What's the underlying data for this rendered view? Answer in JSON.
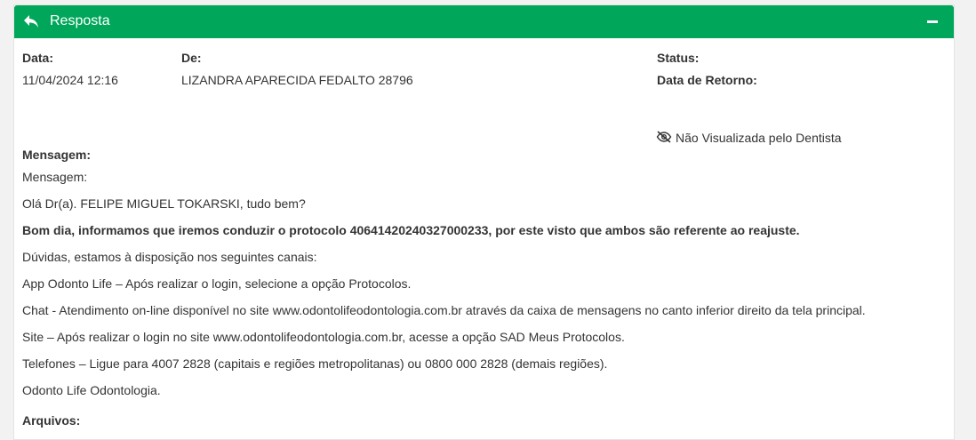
{
  "header": {
    "title": "Resposta",
    "reply_icon": "reply-arrow-icon",
    "collapse_icon": "minus-icon"
  },
  "fields": {
    "date_label": "Data:",
    "date_value": "11/04/2024 12:16",
    "from_label": "De:",
    "from_value": "LIZANDRA APARECIDA FEDALTO 28796",
    "status_label": "Status:",
    "return_label": "Data de Retorno:"
  },
  "visibility": {
    "icon": "eye-slash-icon",
    "text": "Não Visualizada pelo Dentista"
  },
  "message": {
    "label": "Mensagem:",
    "lines": [
      "Mensagem:",
      "Olá Dr(a). FELIPE MIGUEL TOKARSKI, tudo bem?",
      "Bom dia, informamos que iremos conduzir o protocolo 40641420240327000233, por este visto que ambos são referente ao reajuste.",
      "Dúvidas, estamos à disposição nos seguintes canais:",
      "App Odonto Life – Após realizar o login, selecione a opção Protocolos.",
      "Chat - Atendimento on-line disponível no site www.odontolifeodontologia.com.br através da caixa de mensagens no canto inferior direito da tela principal.",
      "Site – Após realizar o login no site www.odontolifeodontologia.com.br, acesse a opção SAD Meus Protocolos.",
      "Telefones – Ligue para 4007 2828 (capitais e regiões metropolitanas) ou 0800 000 2828 (demais regiões).",
      "Odonto Life Odontologia."
    ]
  },
  "files": {
    "label": "Arquivos:"
  },
  "colors": {
    "header_bg": "#00a65a",
    "text": "#333333"
  }
}
